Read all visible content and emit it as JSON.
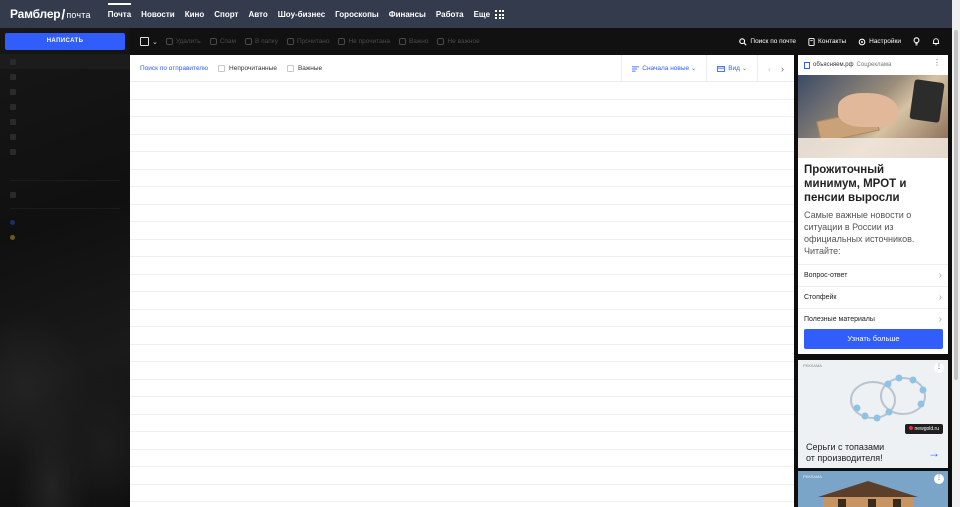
{
  "header": {
    "logo_main": "Рамблер",
    "logo_slash": "/",
    "logo_sub": "почта",
    "nav": [
      {
        "label": "Почта",
        "active": true
      },
      {
        "label": "Новости"
      },
      {
        "label": "Кино"
      },
      {
        "label": "Спорт"
      },
      {
        "label": "Авто"
      },
      {
        "label": "Шоу-бизнес"
      },
      {
        "label": "Гороскопы"
      },
      {
        "label": "Финансы"
      },
      {
        "label": "Работа"
      },
      {
        "label": "Еще"
      }
    ]
  },
  "sidebar": {
    "compose_label": "НАПИСАТЬ"
  },
  "toolbar": {
    "actions": [
      "Удалить",
      "Спам",
      "В папку",
      "Прочитано",
      "Не прочитана",
      "Важно",
      "Не важное"
    ],
    "search_label": "Поиск по почте",
    "contacts_label": "Контакты",
    "settings_label": "Настройки"
  },
  "mail": {
    "filter_sender": "Поиск по отправителю",
    "filter_unread": "Непрочитанные",
    "filter_important": "Важные",
    "sort_label": "Сначала новые",
    "view_label": "Вид",
    "prev_arrow": "‹",
    "next_arrow": "›"
  },
  "ads": {
    "ad1": {
      "source": "объясняем.рф",
      "source2": "Соцреклама",
      "title": "Прожиточный минимум, МРОТ и пенсии выросли",
      "text": "Самые важные новости о ситуации в России из официальных источников. Читайте:",
      "links": [
        "Вопрос-ответ",
        "Стопфейк",
        "Полезные материалы"
      ],
      "button": "Узнать больше"
    },
    "ad2": {
      "label": "РЕКЛАМА",
      "brand": "newgold.ru",
      "text_line1": "Серьги с топазами",
      "text_line2": "от производителя!"
    },
    "ad3": {
      "label": "РЕКЛАМА"
    }
  },
  "colors": {
    "accent": "#315efb",
    "topbar": "#343b4c",
    "toolbar": "#111111"
  }
}
